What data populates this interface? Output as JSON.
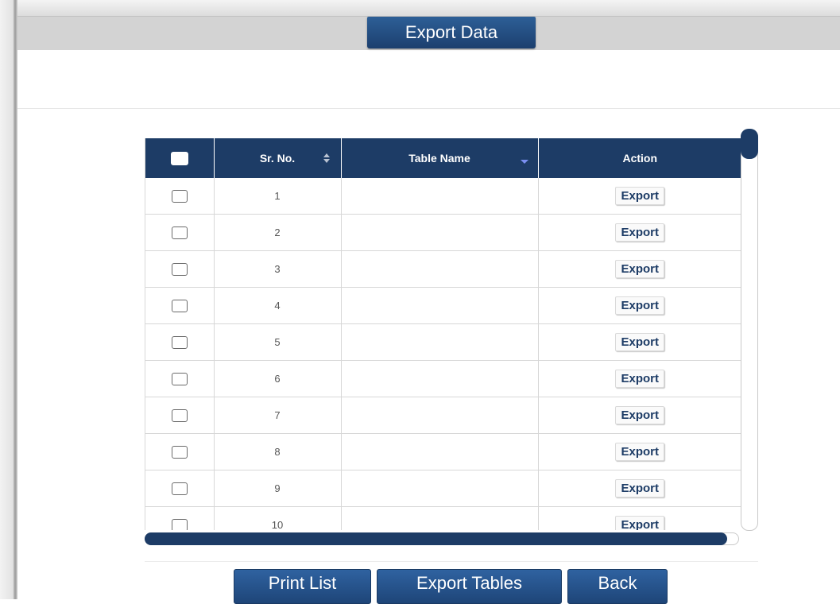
{
  "page": {
    "title": "Export Data"
  },
  "table": {
    "headers": {
      "select_all": "",
      "sr_no": "Sr. No.",
      "table_name": "Table Name",
      "action": "Action"
    },
    "rows": [
      {
        "sr_no": "1",
        "table_name": "",
        "action": "Export"
      },
      {
        "sr_no": "2",
        "table_name": "",
        "action": "Export"
      },
      {
        "sr_no": "3",
        "table_name": "",
        "action": "Export"
      },
      {
        "sr_no": "4",
        "table_name": "",
        "action": "Export"
      },
      {
        "sr_no": "5",
        "table_name": "",
        "action": "Export"
      },
      {
        "sr_no": "6",
        "table_name": "",
        "action": "Export"
      },
      {
        "sr_no": "7",
        "table_name": "",
        "action": "Export"
      },
      {
        "sr_no": "8",
        "table_name": "",
        "action": "Export"
      },
      {
        "sr_no": "9",
        "table_name": "",
        "action": "Export"
      },
      {
        "sr_no": "10",
        "table_name": "",
        "action": "Export"
      }
    ]
  },
  "footer": {
    "print_list": "Print List",
    "export_tables": "Export Tables",
    "back": "Back"
  },
  "colors": {
    "header_bg": "#1d3c66",
    "button_bg": "#2f62a0"
  }
}
